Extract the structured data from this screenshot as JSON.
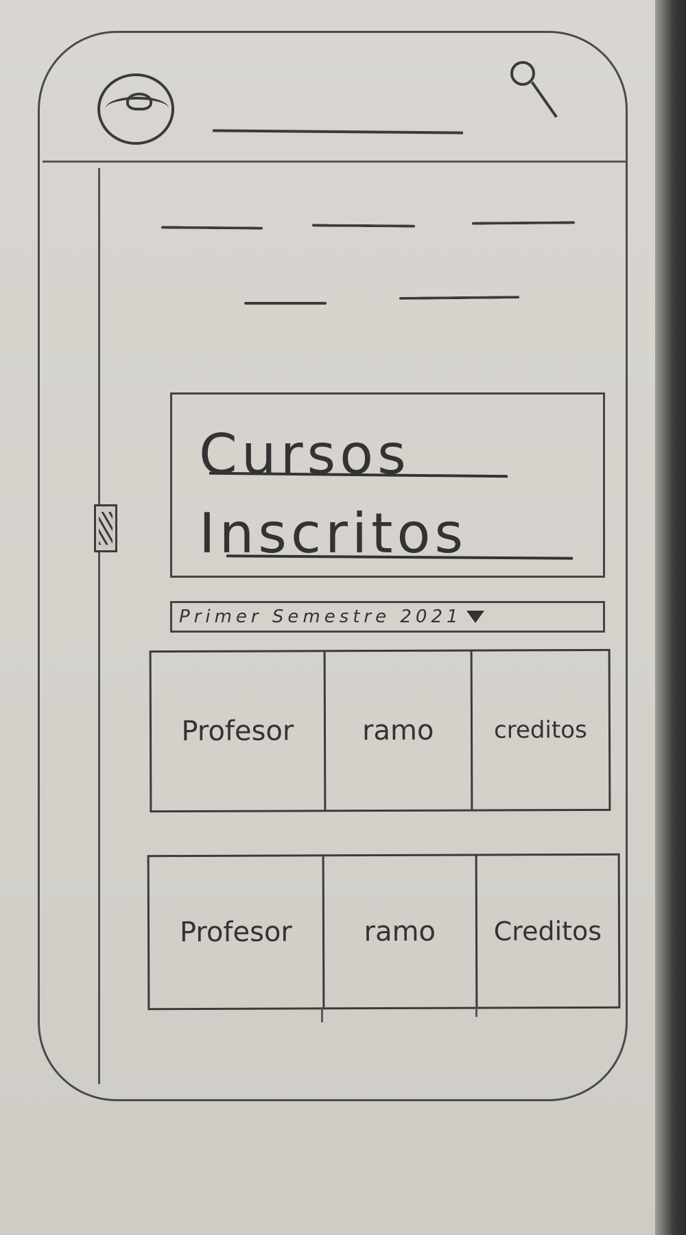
{
  "header": {
    "profile_icon": "user-avatar-icon",
    "search_icon": "search-icon"
  },
  "main": {
    "title": "Cursos Inscritos",
    "semester_select": {
      "selected": "Primer Semestre 2021",
      "caret_icon": "chevron-down-icon"
    },
    "course_rows": [
      {
        "profesor": "Profesor",
        "ramo": "ramo",
        "creditos": "creditos"
      },
      {
        "profesor": "Profesor",
        "ramo": "ramo",
        "creditos": "Creditos"
      }
    ]
  }
}
